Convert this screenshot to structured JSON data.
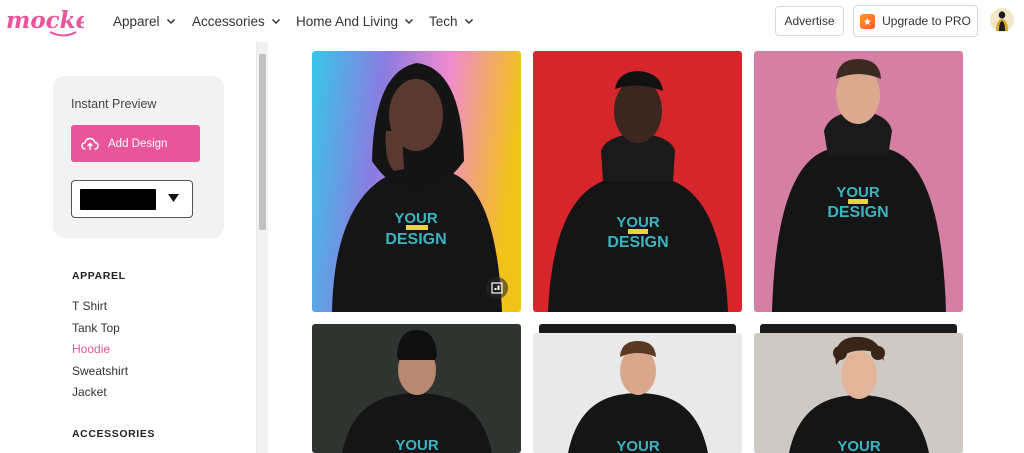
{
  "header": {
    "logo_text": "mockey",
    "nav": [
      {
        "label": "Apparel"
      },
      {
        "label": "Accessories"
      },
      {
        "label": "Home And Living"
      },
      {
        "label": "Tech"
      }
    ],
    "advertise_label": "Advertise",
    "upgrade_label": "Upgrade to PRO",
    "icons": [
      "chevron-down-icon",
      "pro-badge-icon",
      "user-avatar"
    ]
  },
  "sidebar": {
    "preview": {
      "title": "Instant Preview",
      "add_design_label": "Add Design",
      "selected_color": "#000000"
    },
    "sections": [
      {
        "heading": "APPAREL",
        "items": [
          "T Shirt",
          "Tank Top",
          "Hoodie",
          "Sweatshirt",
          "Jacket"
        ],
        "active": "Hoodie"
      },
      {
        "heading": "ACCESSORIES",
        "items": []
      }
    ]
  },
  "grid": {
    "print_line1": "YOUR",
    "print_line2": "DESIGN",
    "cards": [
      {
        "background": "rainbow-gradient"
      },
      {
        "background": "#d6262b"
      },
      {
        "background": "#d57fa4"
      },
      {
        "background": "#2f3430"
      },
      {
        "background": "#e9e9e9"
      },
      {
        "background": "#cfc9c3"
      }
    ]
  },
  "colors": {
    "accent_pink": "#e8559a",
    "print_teal": "#3bb4c1",
    "hoodie": "#151515"
  }
}
